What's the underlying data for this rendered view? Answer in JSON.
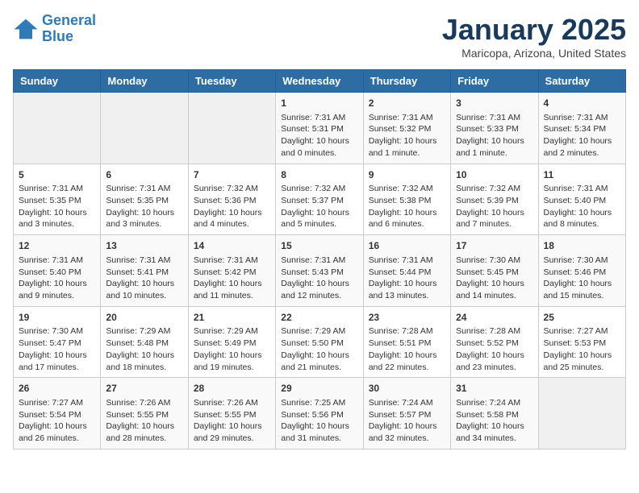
{
  "header": {
    "logo_line1": "General",
    "logo_line2": "Blue",
    "title": "January 2025",
    "subtitle": "Maricopa, Arizona, United States"
  },
  "days_of_week": [
    "Sunday",
    "Monday",
    "Tuesday",
    "Wednesday",
    "Thursday",
    "Friday",
    "Saturday"
  ],
  "weeks": [
    [
      {
        "day": "",
        "sunrise": "",
        "sunset": "",
        "daylight": ""
      },
      {
        "day": "",
        "sunrise": "",
        "sunset": "",
        "daylight": ""
      },
      {
        "day": "",
        "sunrise": "",
        "sunset": "",
        "daylight": ""
      },
      {
        "day": "1",
        "sunrise": "Sunrise: 7:31 AM",
        "sunset": "Sunset: 5:31 PM",
        "daylight": "Daylight: 10 hours and 0 minutes."
      },
      {
        "day": "2",
        "sunrise": "Sunrise: 7:31 AM",
        "sunset": "Sunset: 5:32 PM",
        "daylight": "Daylight: 10 hours and 1 minute."
      },
      {
        "day": "3",
        "sunrise": "Sunrise: 7:31 AM",
        "sunset": "Sunset: 5:33 PM",
        "daylight": "Daylight: 10 hours and 1 minute."
      },
      {
        "day": "4",
        "sunrise": "Sunrise: 7:31 AM",
        "sunset": "Sunset: 5:34 PM",
        "daylight": "Daylight: 10 hours and 2 minutes."
      }
    ],
    [
      {
        "day": "5",
        "sunrise": "Sunrise: 7:31 AM",
        "sunset": "Sunset: 5:35 PM",
        "daylight": "Daylight: 10 hours and 3 minutes."
      },
      {
        "day": "6",
        "sunrise": "Sunrise: 7:31 AM",
        "sunset": "Sunset: 5:35 PM",
        "daylight": "Daylight: 10 hours and 3 minutes."
      },
      {
        "day": "7",
        "sunrise": "Sunrise: 7:32 AM",
        "sunset": "Sunset: 5:36 PM",
        "daylight": "Daylight: 10 hours and 4 minutes."
      },
      {
        "day": "8",
        "sunrise": "Sunrise: 7:32 AM",
        "sunset": "Sunset: 5:37 PM",
        "daylight": "Daylight: 10 hours and 5 minutes."
      },
      {
        "day": "9",
        "sunrise": "Sunrise: 7:32 AM",
        "sunset": "Sunset: 5:38 PM",
        "daylight": "Daylight: 10 hours and 6 minutes."
      },
      {
        "day": "10",
        "sunrise": "Sunrise: 7:32 AM",
        "sunset": "Sunset: 5:39 PM",
        "daylight": "Daylight: 10 hours and 7 minutes."
      },
      {
        "day": "11",
        "sunrise": "Sunrise: 7:31 AM",
        "sunset": "Sunset: 5:40 PM",
        "daylight": "Daylight: 10 hours and 8 minutes."
      }
    ],
    [
      {
        "day": "12",
        "sunrise": "Sunrise: 7:31 AM",
        "sunset": "Sunset: 5:40 PM",
        "daylight": "Daylight: 10 hours and 9 minutes."
      },
      {
        "day": "13",
        "sunrise": "Sunrise: 7:31 AM",
        "sunset": "Sunset: 5:41 PM",
        "daylight": "Daylight: 10 hours and 10 minutes."
      },
      {
        "day": "14",
        "sunrise": "Sunrise: 7:31 AM",
        "sunset": "Sunset: 5:42 PM",
        "daylight": "Daylight: 10 hours and 11 minutes."
      },
      {
        "day": "15",
        "sunrise": "Sunrise: 7:31 AM",
        "sunset": "Sunset: 5:43 PM",
        "daylight": "Daylight: 10 hours and 12 minutes."
      },
      {
        "day": "16",
        "sunrise": "Sunrise: 7:31 AM",
        "sunset": "Sunset: 5:44 PM",
        "daylight": "Daylight: 10 hours and 13 minutes."
      },
      {
        "day": "17",
        "sunrise": "Sunrise: 7:30 AM",
        "sunset": "Sunset: 5:45 PM",
        "daylight": "Daylight: 10 hours and 14 minutes."
      },
      {
        "day": "18",
        "sunrise": "Sunrise: 7:30 AM",
        "sunset": "Sunset: 5:46 PM",
        "daylight": "Daylight: 10 hours and 15 minutes."
      }
    ],
    [
      {
        "day": "19",
        "sunrise": "Sunrise: 7:30 AM",
        "sunset": "Sunset: 5:47 PM",
        "daylight": "Daylight: 10 hours and 17 minutes."
      },
      {
        "day": "20",
        "sunrise": "Sunrise: 7:29 AM",
        "sunset": "Sunset: 5:48 PM",
        "daylight": "Daylight: 10 hours and 18 minutes."
      },
      {
        "day": "21",
        "sunrise": "Sunrise: 7:29 AM",
        "sunset": "Sunset: 5:49 PM",
        "daylight": "Daylight: 10 hours and 19 minutes."
      },
      {
        "day": "22",
        "sunrise": "Sunrise: 7:29 AM",
        "sunset": "Sunset: 5:50 PM",
        "daylight": "Daylight: 10 hours and 21 minutes."
      },
      {
        "day": "23",
        "sunrise": "Sunrise: 7:28 AM",
        "sunset": "Sunset: 5:51 PM",
        "daylight": "Daylight: 10 hours and 22 minutes."
      },
      {
        "day": "24",
        "sunrise": "Sunrise: 7:28 AM",
        "sunset": "Sunset: 5:52 PM",
        "daylight": "Daylight: 10 hours and 23 minutes."
      },
      {
        "day": "25",
        "sunrise": "Sunrise: 7:27 AM",
        "sunset": "Sunset: 5:53 PM",
        "daylight": "Daylight: 10 hours and 25 minutes."
      }
    ],
    [
      {
        "day": "26",
        "sunrise": "Sunrise: 7:27 AM",
        "sunset": "Sunset: 5:54 PM",
        "daylight": "Daylight: 10 hours and 26 minutes."
      },
      {
        "day": "27",
        "sunrise": "Sunrise: 7:26 AM",
        "sunset": "Sunset: 5:55 PM",
        "daylight": "Daylight: 10 hours and 28 minutes."
      },
      {
        "day": "28",
        "sunrise": "Sunrise: 7:26 AM",
        "sunset": "Sunset: 5:55 PM",
        "daylight": "Daylight: 10 hours and 29 minutes."
      },
      {
        "day": "29",
        "sunrise": "Sunrise: 7:25 AM",
        "sunset": "Sunset: 5:56 PM",
        "daylight": "Daylight: 10 hours and 31 minutes."
      },
      {
        "day": "30",
        "sunrise": "Sunrise: 7:24 AM",
        "sunset": "Sunset: 5:57 PM",
        "daylight": "Daylight: 10 hours and 32 minutes."
      },
      {
        "day": "31",
        "sunrise": "Sunrise: 7:24 AM",
        "sunset": "Sunset: 5:58 PM",
        "daylight": "Daylight: 10 hours and 34 minutes."
      },
      {
        "day": "",
        "sunrise": "",
        "sunset": "",
        "daylight": ""
      }
    ]
  ]
}
